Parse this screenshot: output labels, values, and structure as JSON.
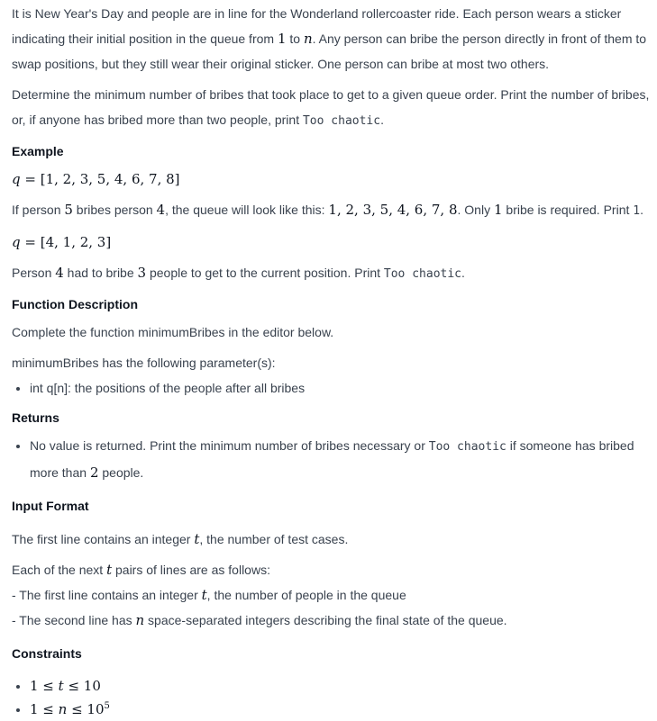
{
  "intro": {
    "p1_a": "It is New Year's Day and people are in line for the Wonderland rollercoaster ride. Each person wears a sticker indicating their initial position in the queue from ",
    "p1_one": "1",
    "p1_to": " to ",
    "p1_n": "n",
    "p1_b": ". Any person can bribe the person directly in front of them to swap positions, but they still wear their original sticker. One person can bribe at most two others.",
    "p2_a": "Determine the minimum number of bribes that took place to get to a given queue order. Print the number of bribes, or, if anyone has bribed more than two people, print ",
    "p2_code": "Too chaotic",
    "p2_b": "."
  },
  "example": {
    "heading": "Example",
    "q1_var": "q",
    "q1_eq": " = [1, 2, 3, 5, 4, 6, 7, 8]",
    "exp1_a": "If person ",
    "exp1_5": "5",
    "exp1_b": " bribes person ",
    "exp1_4": "4",
    "exp1_c": ", the queue will look like this: ",
    "exp1_seq": "1, 2, 3, 5, 4, 6, 7, 8",
    "exp1_d": ". Only ",
    "exp1_1": "1",
    "exp1_e": " bribe is required. Print ",
    "exp1_print": "1",
    "exp1_f": ".",
    "q2_var": "q",
    "q2_eq": " = [4, 1, 2, 3]",
    "exp2_a": "Person ",
    "exp2_4": "4",
    "exp2_b": " had to bribe ",
    "exp2_3": "3",
    "exp2_c": " people to get to the current position. Print ",
    "exp2_code": "Too chaotic",
    "exp2_d": "."
  },
  "function_description": {
    "heading": "Function Description",
    "line1": "Complete the function minimumBribes in the editor below.",
    "line2": "minimumBribes has the following parameter(s):",
    "param": "int q[n]: the positions of the people after all bribes"
  },
  "returns": {
    "heading": "Returns",
    "item_a": "No value is returned. Print the minimum number of bribes necessary or ",
    "item_code": "Too chaotic",
    "item_b": " if someone has bribed more than ",
    "item_2": "2",
    "item_c": " people."
  },
  "input_format": {
    "heading": "Input Format",
    "l1_a": "The first line contains an integer ",
    "l1_t": "t",
    "l1_b": ", the number of test cases.",
    "l2_a": "Each of the next ",
    "l2_t": "t",
    "l2_b": " pairs of lines are as follows:",
    "l3_a": "- The first line contains an integer ",
    "l3_t": "t",
    "l3_b": ", the number of people in the queue",
    "l4_a": "- The second line has ",
    "l4_n": "n",
    "l4_b": " space-separated integers describing the final state of the queue."
  },
  "constraints": {
    "heading": "Constraints",
    "c1_a": "1 ≤ ",
    "c1_t": "t",
    "c1_b": " ≤ 10",
    "c2_a": "1 ≤ ",
    "c2_n": "n",
    "c2_b": " ≤ 10",
    "c2_exp": "5"
  }
}
